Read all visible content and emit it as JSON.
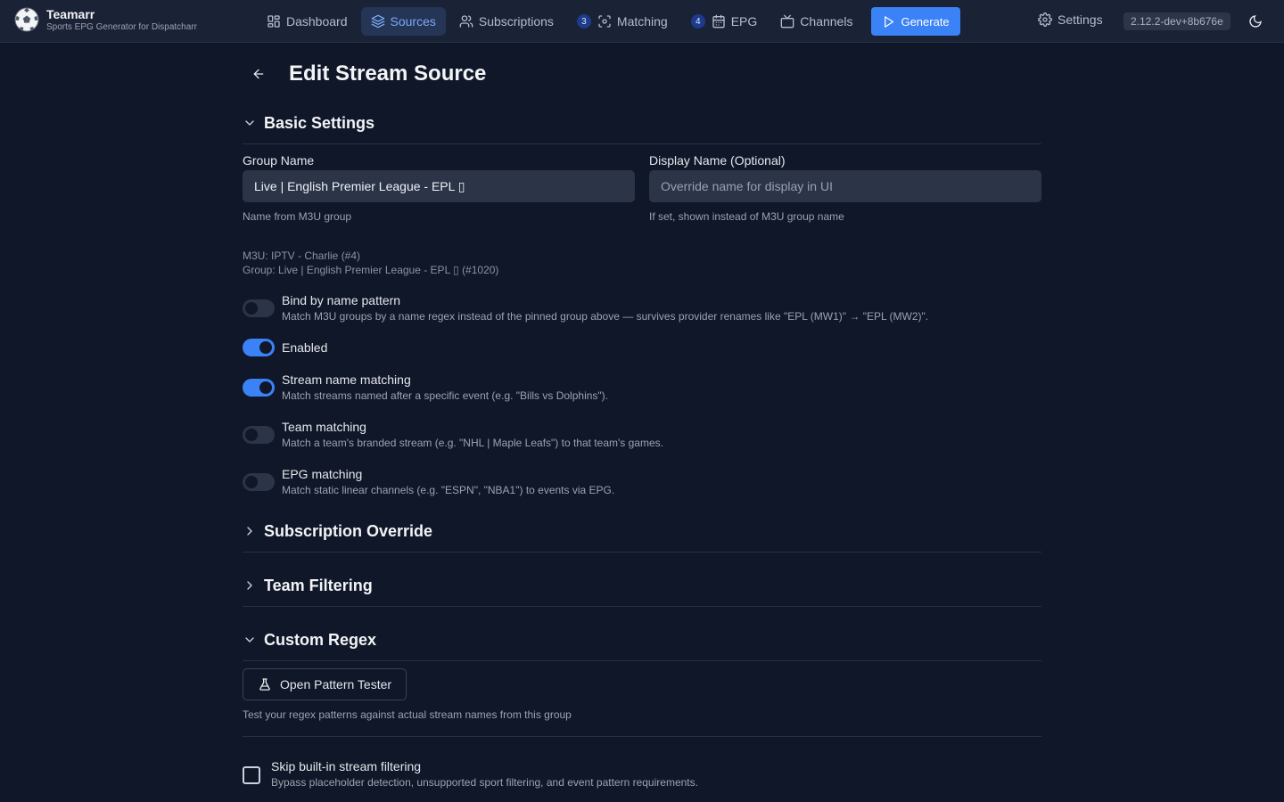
{
  "brand": {
    "title": "Teamarr",
    "subtitle": "Sports EPG Generator for Dispatcharr",
    "logo_icon": "soccer-ball-icon"
  },
  "nav": {
    "items": [
      {
        "label": "Dashboard",
        "icon": "dashboard-icon"
      },
      {
        "label": "Sources",
        "icon": "layers-icon",
        "active": true
      },
      {
        "label": "Subscriptions",
        "icon": "users-icon"
      },
      {
        "label": "Matching",
        "icon": "scan-icon",
        "badge": "3"
      },
      {
        "label": "EPG",
        "icon": "calendar-icon",
        "badge": "4"
      },
      {
        "label": "Channels",
        "icon": "tv-icon"
      }
    ],
    "generate_label": "Generate",
    "settings_label": "Settings",
    "version": "2.12.2-dev+8b676e"
  },
  "page": {
    "title": "Edit Stream Source"
  },
  "basic": {
    "title": "Basic Settings",
    "group_name_label": "Group Name",
    "group_name_value": "Live | English Premier League - EPL ▯",
    "group_name_help": "Name from M3U group",
    "display_name_label": "Display Name (Optional)",
    "display_name_placeholder": "Override name for display in UI",
    "display_name_help": "If set, shown instead of M3U group name",
    "meta_m3u": "M3U: IPTV - Charlie (#4)",
    "meta_group": "Group: Live | English Premier League - EPL ▯ (#1020)"
  },
  "toggles": [
    {
      "label": "Bind by name pattern",
      "desc": "Match M3U groups by a name regex instead of the pinned group above — survives provider renames like \"EPL (MW1)\" → \"EPL (MW2)\".",
      "on": false
    },
    {
      "label": "Enabled",
      "desc": "",
      "on": true
    },
    {
      "label": "Stream name matching",
      "desc": "Match streams named after a specific event (e.g. \"Bills vs Dolphins\").",
      "on": true
    },
    {
      "label": "Team matching",
      "desc": "Match a team's branded stream (e.g. \"NHL | Maple Leafs\") to that team's games.",
      "on": false
    },
    {
      "label": "EPG matching",
      "desc": "Match static linear channels (e.g. \"ESPN\", \"NBA1\") to events via EPG.",
      "on": false
    }
  ],
  "sections": {
    "subscription_override": "Subscription Override",
    "team_filtering": "Team Filtering",
    "custom_regex": "Custom Regex"
  },
  "regex": {
    "tester_label": "Open Pattern Tester",
    "tester_help": "Test your regex patterns against actual stream names from this group"
  },
  "skip_filtering": {
    "label": "Skip built-in stream filtering",
    "desc": "Bypass placeholder detection, unsupported sport filtering, and event pattern requirements.",
    "checked": false
  }
}
